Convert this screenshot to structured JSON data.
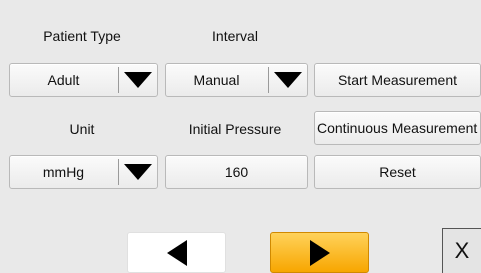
{
  "labels": {
    "patient_type": "Patient Type",
    "interval": "Interval",
    "unit": "Unit",
    "initial_pressure": "Initial Pressure"
  },
  "patient_type": {
    "value": "Adult",
    "icon": "dropdown-arrow-icon"
  },
  "interval": {
    "value": "Manual",
    "icon": "dropdown-arrow-icon"
  },
  "unit": {
    "value": "mmHg",
    "icon": "dropdown-arrow-icon"
  },
  "initial_pressure": {
    "value": "160"
  },
  "actions": {
    "start": "Start Measurement",
    "continuous": "Continuous Measurement",
    "reset": "Reset"
  },
  "nav": {
    "prev_icon": "left-triangle-icon",
    "next_icon": "right-triangle-icon",
    "next_color": "#f7a600",
    "close_label": "X"
  }
}
